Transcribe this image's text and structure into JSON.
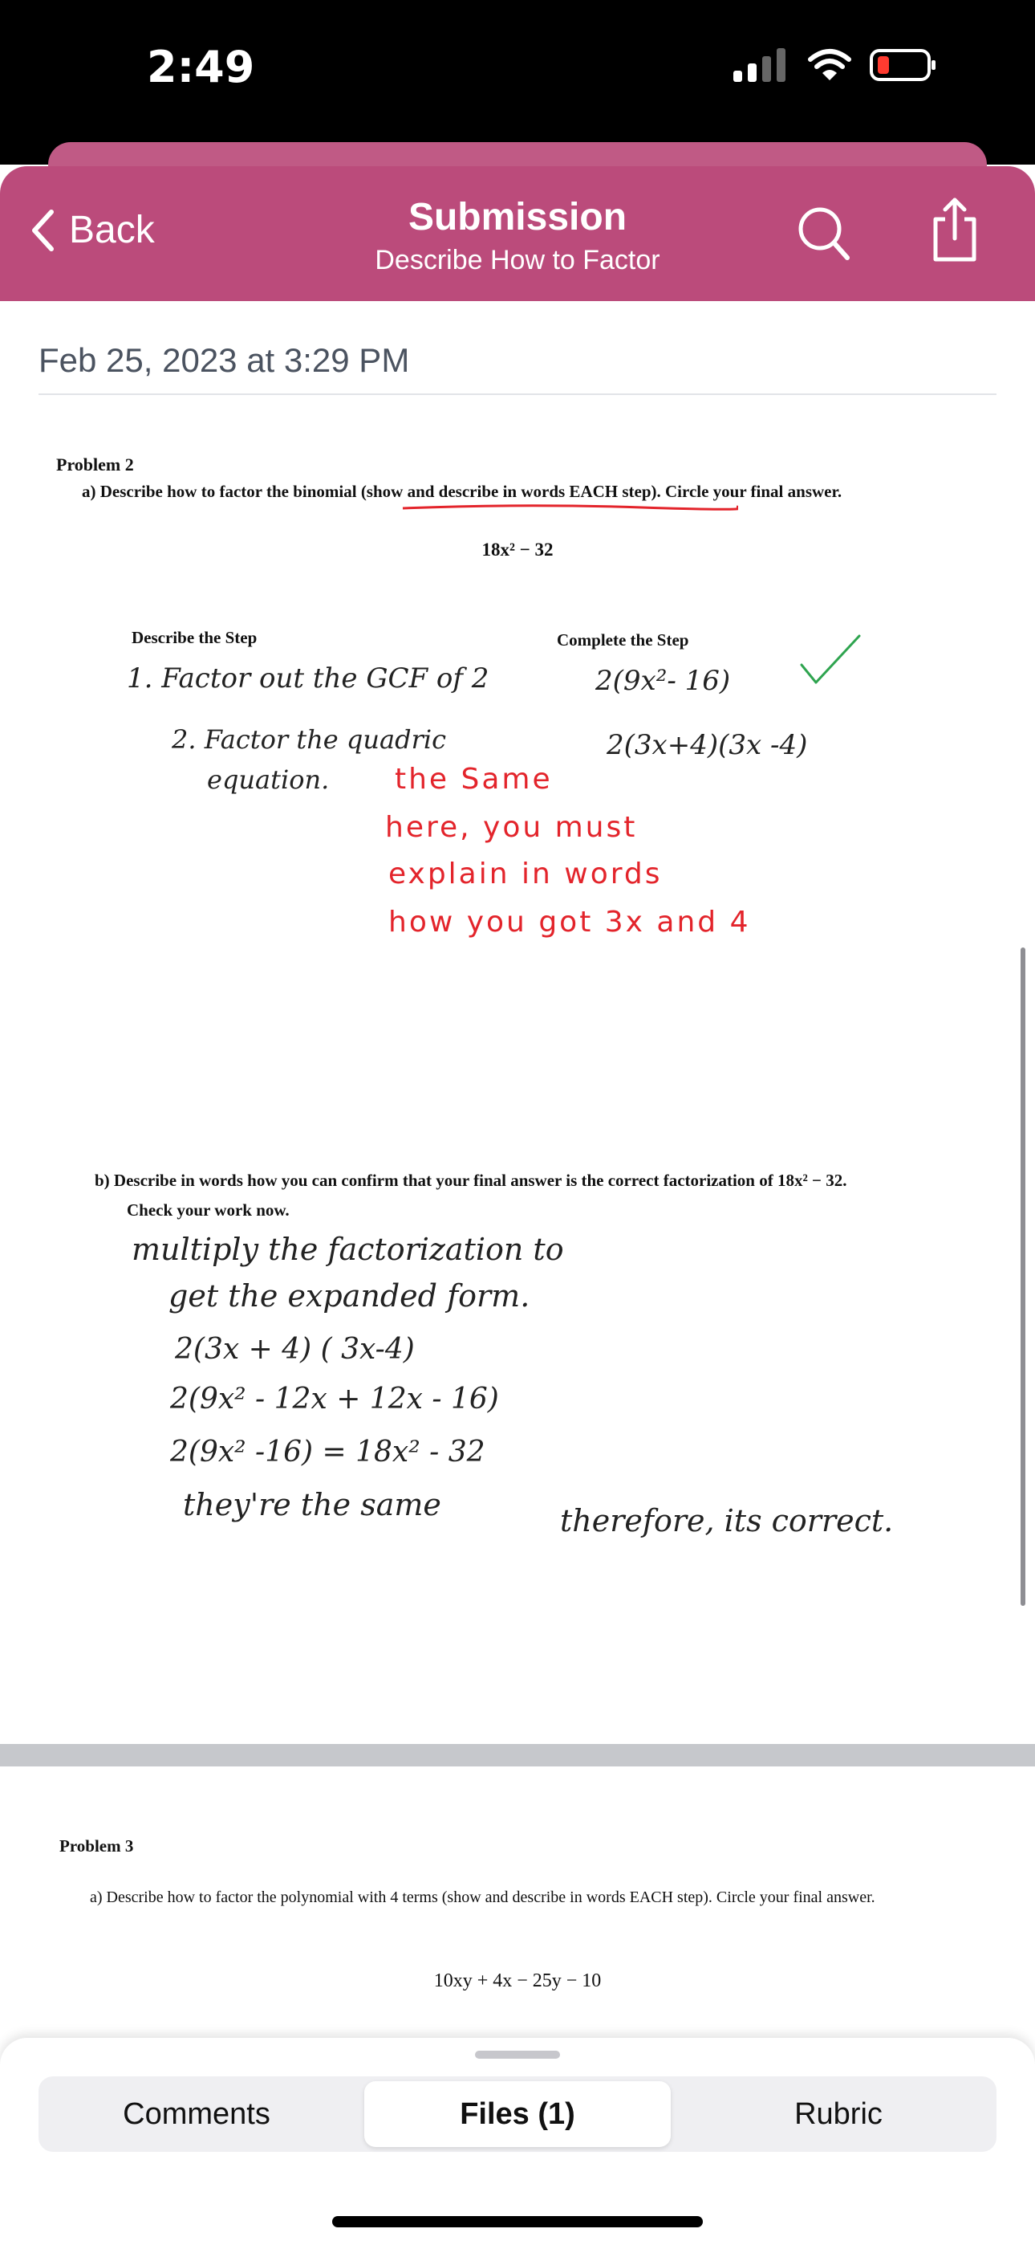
{
  "status_bar": {
    "time": "2:49",
    "icons": [
      "cellular-signal-icon",
      "wifi-icon",
      "battery-low-icon"
    ]
  },
  "header": {
    "back_label": "Back",
    "title": "Submission",
    "subtitle": "Describe How to Factor",
    "accent_color": "#bb4b7b"
  },
  "submission": {
    "date": "Feb 25, 2023 at 3:29 PM"
  },
  "document": {
    "problem2": {
      "label": "Problem 2",
      "part_a": "a)  Describe how to factor the binomial (show and describe in words EACH step). Circle your final answer.",
      "expression": "18x² − 32",
      "col_describe": "Describe the Step",
      "col_complete": "Complete the Step",
      "step1_describe": "1. Factor out the GCF of 2",
      "step1_complete": "2(9x²- 16)",
      "step2_describe_line1": "2. Factor the quadric",
      "step2_describe_line2": "equation.",
      "step2_complete": "2(3x+4)(3x -4)",
      "teacher_comment_1": "the Same",
      "teacher_comment_2": "here, you must",
      "teacher_comment_3": "explain  in words",
      "teacher_comment_4": "how you got 3x and 4",
      "part_b_line1": "b)  Describe in words how you can confirm that your final answer is the correct factorization of  18x² − 32.",
      "part_b_line2": "Check your work now.",
      "answer_line1": "multiply the factorization to",
      "answer_line2": "get    the expanded form.",
      "answer_line3": "2(3x + 4) ( 3x-4)",
      "answer_line4": "2(9x² - 12x + 12x - 16)",
      "answer_line5": "2(9x² -16) =  18x² - 32",
      "answer_line6": "they're  the same",
      "answer_line7": "therefore, its correct."
    },
    "problem3": {
      "label": "Problem 3",
      "part_a": "a)  Describe how to factor the polynomial with 4 terms (show and describe in words EACH step). Circle your final answer.",
      "expression": "10xy + 4x − 25y − 10"
    }
  },
  "bottom_tabs": {
    "comments": "Comments",
    "files": "Files (1)",
    "rubric": "Rubric",
    "selected": "Files (1)"
  }
}
